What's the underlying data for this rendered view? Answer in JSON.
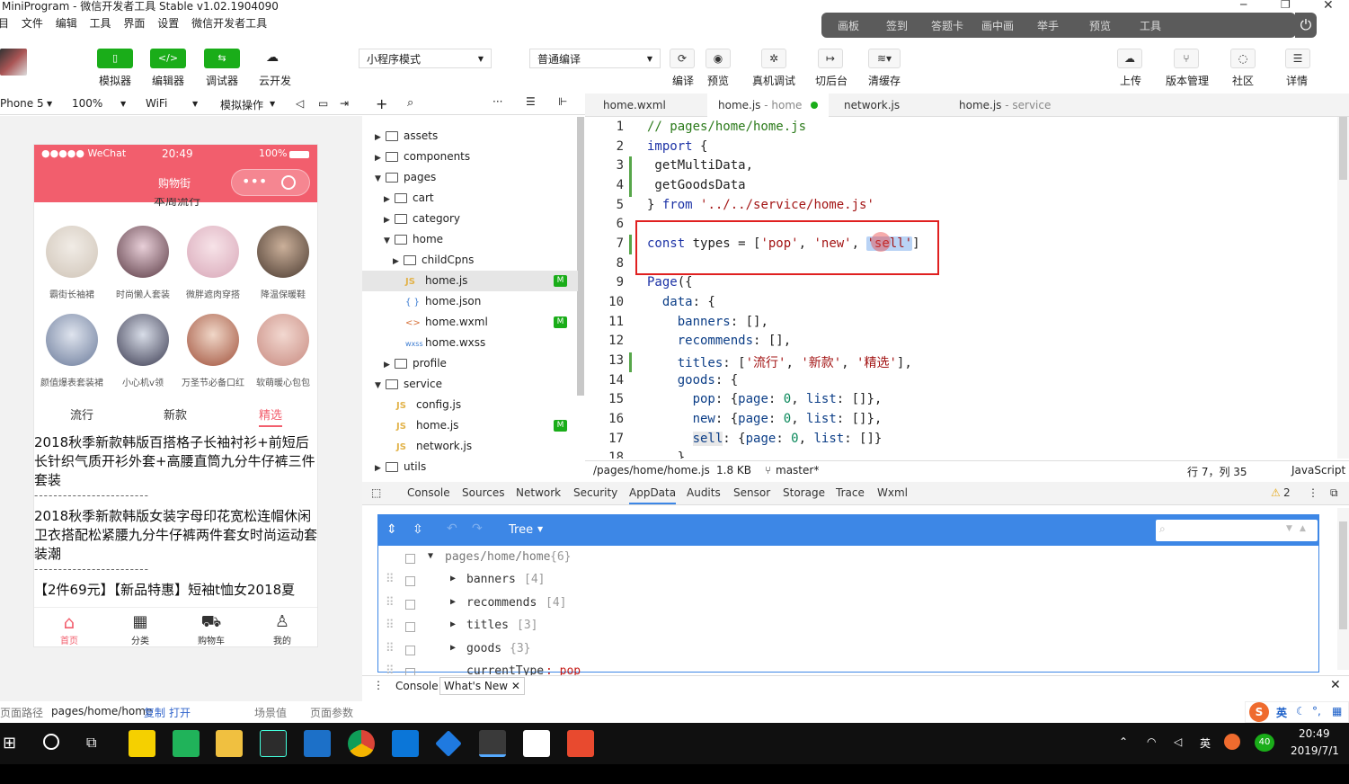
{
  "window": {
    "title": "MiniProgram - 微信开发者工具 Stable v1.02.1904090"
  },
  "menu": [
    "项目",
    "文件",
    "编辑",
    "工具",
    "界面",
    "设置",
    "微信开发者工具"
  ],
  "floatbar": [
    "画板",
    "签到",
    "答题卡",
    "画中画",
    "举手",
    "预览",
    "工具"
  ],
  "toolbar": {
    "simulator": "模拟器",
    "editor": "编辑器",
    "debugger": "调试器",
    "cloud": "云开发",
    "mode": "小程序模式",
    "compile_mode": "普通编译",
    "compile": "编译",
    "preview": "预览",
    "real_debug": "真机调试",
    "background": "切后台",
    "clear_cache": "清缓存",
    "upload": "上传",
    "version": "版本管理",
    "community": "社区",
    "details": "详情"
  },
  "devicebar": {
    "device": "Phone 5",
    "zoom": "100%",
    "network": "WiFi",
    "sim_ops": "模拟操作"
  },
  "phone": {
    "status": {
      "carrier": "●●●●● WeChat",
      "time": "20:49",
      "battery": "100%"
    },
    "nav_title": "购物街",
    "section_title": "本周流行",
    "recommends": [
      "霸街长袖裙",
      "时尚懒人套装",
      "微胖遮肉穿搭",
      "降温保暖鞋",
      "颜值爆表套装裙",
      "小心机v领",
      "万圣节必备口红",
      "软萌暖心包包"
    ],
    "tabs": [
      "流行",
      "新款",
      "精选"
    ],
    "goods": [
      "2018秋季新款韩版百搭格子长袖衬衫+前短后长针织气质开衫外套+高腰直筒九分牛仔裤三件套装",
      "------------------------",
      "2018秋季新款韩版女装字母印花宽松连帽休闲卫衣搭配松紧腰九分牛仔裤两件套女时尚运动套装潮",
      "------------------------",
      "【2件69元】【新品特惠】短袖t恤女2018夏"
    ],
    "tabbar": [
      "首页",
      "分类",
      "购物车",
      "我的"
    ]
  },
  "pathbar": {
    "label": "页面路径",
    "path": "pages/home/home",
    "copy": "复制",
    "open": "打开",
    "scene": "场景值",
    "params": "页面参数"
  },
  "filetree": [
    {
      "name": "assets",
      "type": "folder",
      "depth": 0,
      "open": false
    },
    {
      "name": "components",
      "type": "folder",
      "depth": 0,
      "open": false
    },
    {
      "name": "pages",
      "type": "folder",
      "depth": 0,
      "open": true
    },
    {
      "name": "cart",
      "type": "folder",
      "depth": 1,
      "open": false
    },
    {
      "name": "category",
      "type": "folder",
      "depth": 1,
      "open": false
    },
    {
      "name": "home",
      "type": "folder",
      "depth": 1,
      "open": true
    },
    {
      "name": "childCpns",
      "type": "folder",
      "depth": 2,
      "open": false
    },
    {
      "name": "home.js",
      "type": "js",
      "depth": 2,
      "badge": "M",
      "selected": true
    },
    {
      "name": "home.json",
      "type": "json",
      "depth": 2
    },
    {
      "name": "home.wxml",
      "type": "wxml",
      "depth": 2,
      "badge": "M"
    },
    {
      "name": "home.wxss",
      "type": "wxss",
      "depth": 2
    },
    {
      "name": "profile",
      "type": "folder",
      "depth": 1,
      "open": false
    },
    {
      "name": "service",
      "type": "folder",
      "depth": 0,
      "open": true
    },
    {
      "name": "config.js",
      "type": "js",
      "depth": 1
    },
    {
      "name": "home.js",
      "type": "js",
      "depth": 1,
      "badge": "M"
    },
    {
      "name": "network.js",
      "type": "js",
      "depth": 1
    },
    {
      "name": "utils",
      "type": "folder",
      "depth": 0,
      "open": false
    }
  ],
  "editor_tabs": [
    {
      "name": "home.wxml",
      "sub": ""
    },
    {
      "name": "home.js",
      "sub": " - home"
    },
    {
      "name": "network.js",
      "sub": ""
    },
    {
      "name": "home.js",
      "sub": " - service"
    }
  ],
  "code_lines": [
    "1",
    "2",
    "3",
    "4",
    "5",
    "6",
    "7",
    "8",
    "9",
    "10",
    "11",
    "12",
    "13",
    "14",
    "15",
    "16",
    "17",
    "18"
  ],
  "statusline": {
    "file": "/pages/home/home.js",
    "size": "1.8 KB",
    "branch": "master*",
    "pos": "行 7，列 35",
    "lang": "JavaScript"
  },
  "devtools_tabs": [
    "Console",
    "Sources",
    "Network",
    "Security",
    "AppData",
    "Audits",
    "Sensor",
    "Storage",
    "Trace",
    "Wxml"
  ],
  "devtools_warn": "2",
  "appdata": {
    "view": "Tree",
    "root": "pages/home/home",
    "root_count": "{6}",
    "rows": [
      {
        "key": "banners",
        "count": "[4]"
      },
      {
        "key": "recommends",
        "count": "[4]"
      },
      {
        "key": "titles",
        "count": "[3]"
      },
      {
        "key": "goods",
        "count": "{3}"
      },
      {
        "key": "currentType",
        "count": ": pop"
      }
    ]
  },
  "drawer": {
    "console": "Console",
    "whatsnew": "What's New"
  },
  "tray": {
    "ime": "英",
    "badge": "40",
    "time": "20:49",
    "date": "2019/7/1"
  },
  "sogou": "英"
}
